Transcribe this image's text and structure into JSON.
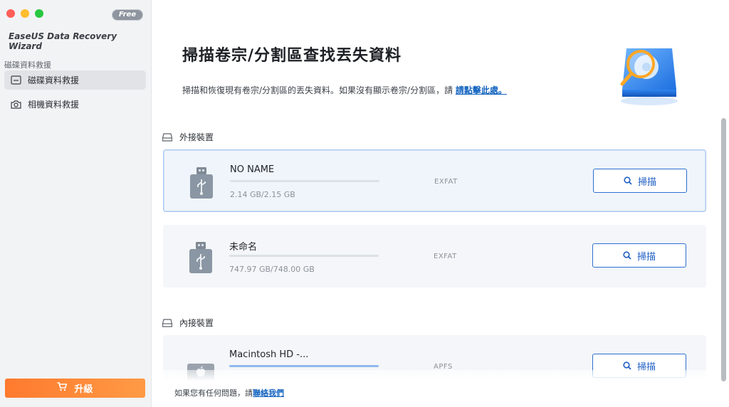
{
  "app": {
    "title": "EaseUS Data Recovery Wizard",
    "badge": "Free"
  },
  "sidebar": {
    "section_label": "磁碟資料救援",
    "items": [
      {
        "label": "磁碟資料救援",
        "icon": "drive-icon",
        "active": true
      },
      {
        "label": "相機資料救援",
        "icon": "camera-icon",
        "active": false
      }
    ],
    "upgrade_label": "升級",
    "upgrade_icon": "cart-icon"
  },
  "main": {
    "title": "掃描卷宗/分割區查找丟失資料",
    "description": "掃描和恢復現有卷宗/分割區的丟失資料。如果沒有顯示卷宗/分割區，請 ",
    "description_link": "請點擊此處。",
    "groups": {
      "external": {
        "label": "外接裝置",
        "drives": [
          {
            "name": "NO NAME",
            "size": "2.14 GB/2.15 GB",
            "fs": "EXFAT",
            "used_fraction": 0.995,
            "selected": true,
            "icon": "usb-drive-icon"
          },
          {
            "name": "未命名",
            "size": "747.97 GB/748.00 GB",
            "fs": "EXFAT",
            "used_fraction": 0.99996,
            "selected": false,
            "icon": "usb-drive-icon"
          }
        ]
      },
      "internal": {
        "label": "內接裝置",
        "drives": [
          {
            "name": "Macintosh HD -...",
            "size": "",
            "fs": "APFS",
            "used_fraction": 1.0,
            "selected": false,
            "icon": "apple-disk-icon"
          }
        ]
      }
    },
    "scan_label": "掃描"
  },
  "footer": {
    "text": "如果您有任何問題，請",
    "link": "聯絡我們"
  },
  "colors": {
    "accent": "#2e6fd0",
    "link": "#1565c0",
    "upgrade": "#ff8a3a",
    "progress": "#8fb8ec"
  }
}
